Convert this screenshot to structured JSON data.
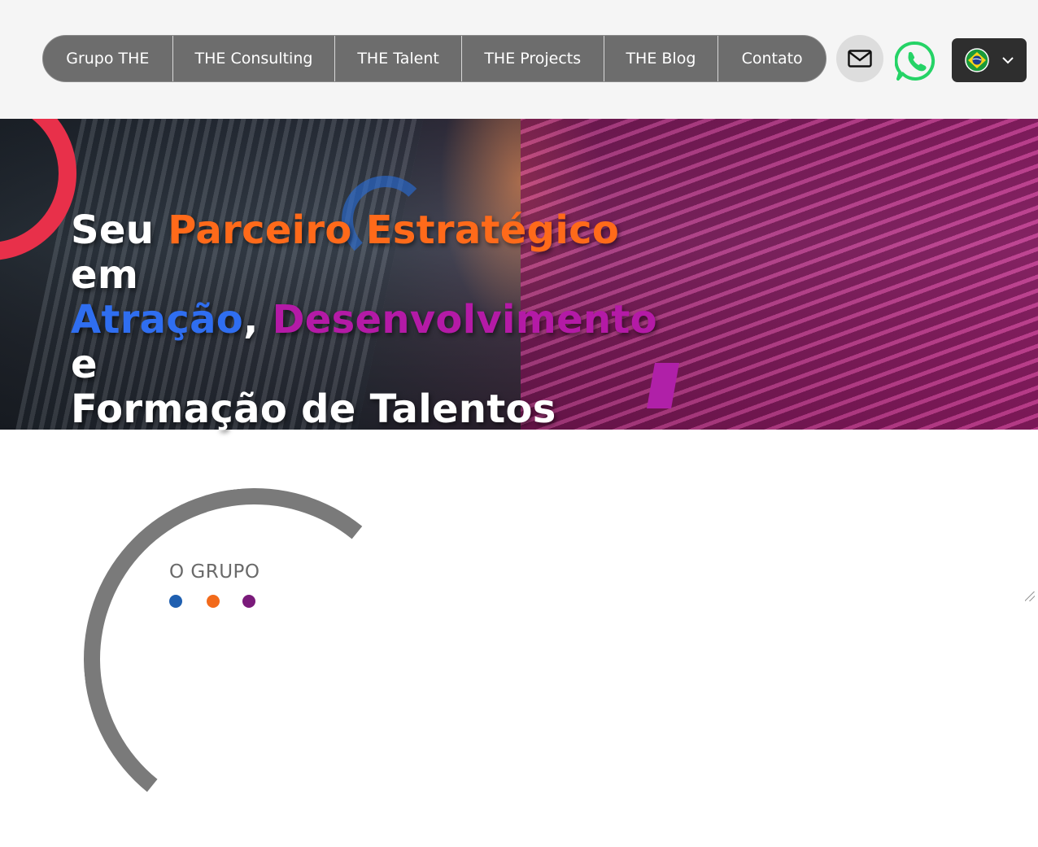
{
  "nav": {
    "items": [
      {
        "label": "Grupo THE",
        "width": 160
      },
      {
        "label": "THE Consulting",
        "width": 200
      },
      {
        "label": "THE Talent",
        "width": 156
      },
      {
        "label": "THE Projects",
        "width": 175
      },
      {
        "label": "THE Blog",
        "width": 141
      },
      {
        "label": "Contato",
        "width": 132
      }
    ]
  },
  "contact": {
    "mail_icon": "mail-icon",
    "whatsapp_icon": "whatsapp-icon"
  },
  "language": {
    "selected": "pt-BR",
    "flag_icon": "brazil-flag-icon"
  },
  "hero": {
    "line1_a": "Seu ",
    "line1_b": "Parceiro Estratégico",
    "line1_c": " em",
    "line2_a": "Atração",
    "line2_b": ", ",
    "line2_c": "Desenvolvimento",
    "line2_d": " e",
    "line3": "Formação de Talentos"
  },
  "section": {
    "title": "O GRUPO",
    "dots": [
      "#1f5fb0",
      "#f26a1b",
      "#7a1a7a"
    ]
  },
  "colors": {
    "orange": "#ff6a1a",
    "blue": "#2f6ef0",
    "purple": "#b41aa6",
    "whatsapp": "#25d366"
  }
}
